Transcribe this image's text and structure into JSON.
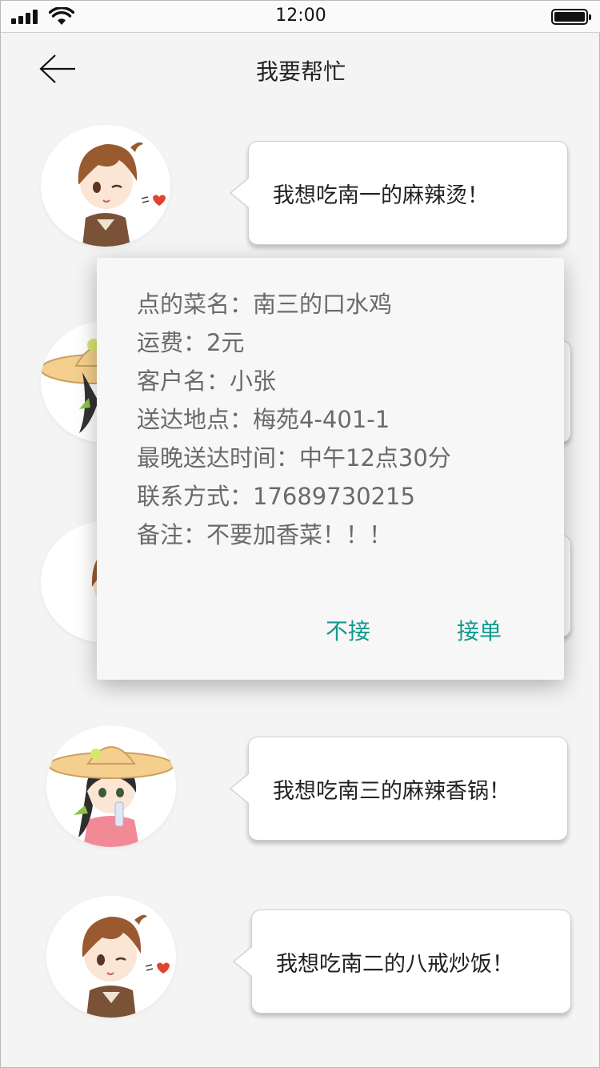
{
  "status_bar": {
    "time": "12:00"
  },
  "header": {
    "title": "我要帮忙"
  },
  "messages": [
    {
      "text": "我想吃南一的麻辣烫！",
      "avatar": "boy-avatar"
    },
    {
      "text": "",
      "avatar": "girl-avatar"
    },
    {
      "text": "",
      "avatar": "boy-avatar"
    },
    {
      "text": "我想吃南三的麻辣香锅！",
      "avatar": "girl-avatar"
    },
    {
      "text": "我想吃南二的八戒炒饭！",
      "avatar": "boy-avatar"
    }
  ],
  "dialog": {
    "lines": [
      "点的菜名：南三的口水鸡",
      "运费：2元",
      "客户名：小张",
      "送达地点：梅苑4-401-1",
      "最晚送达时间：中午12点30分",
      "联系方式：17689730215",
      "备注：不要加香菜！！！"
    ],
    "reject_label": "不接",
    "accept_label": "接单"
  },
  "colors": {
    "accent": "#12998d",
    "background": "#f4f4f4"
  }
}
